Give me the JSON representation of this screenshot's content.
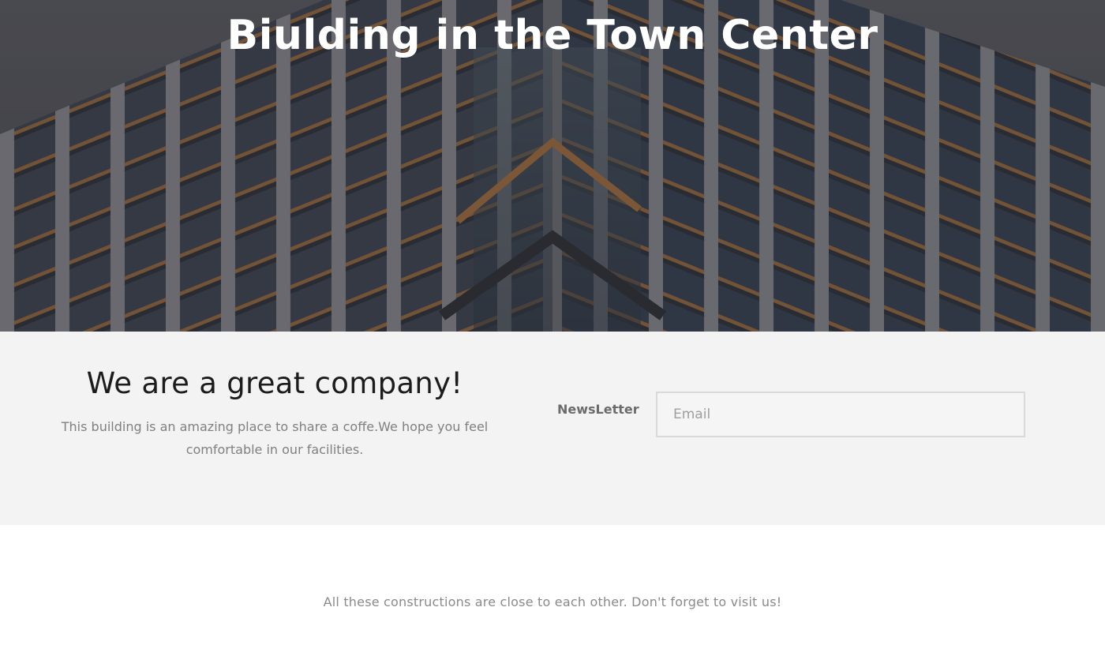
{
  "hero": {
    "title": "Biulding in the Town Center",
    "image_name": "building-facade-image"
  },
  "about": {
    "heading": "We are a great company!",
    "text": "This building is an amazing place to share a coffe.We hope you feel comfortable in our facilities."
  },
  "newsletter": {
    "label": "NewsLetter",
    "email_placeholder": "Email",
    "email_value": ""
  },
  "footer": {
    "note": "All these constructions are close to each other. Don't forget to visit us!"
  },
  "colors": {
    "band_background": "#f3f3f3",
    "heading_text": "#1c1c1c",
    "body_text": "#808080",
    "hero_title": "#ffffff"
  }
}
